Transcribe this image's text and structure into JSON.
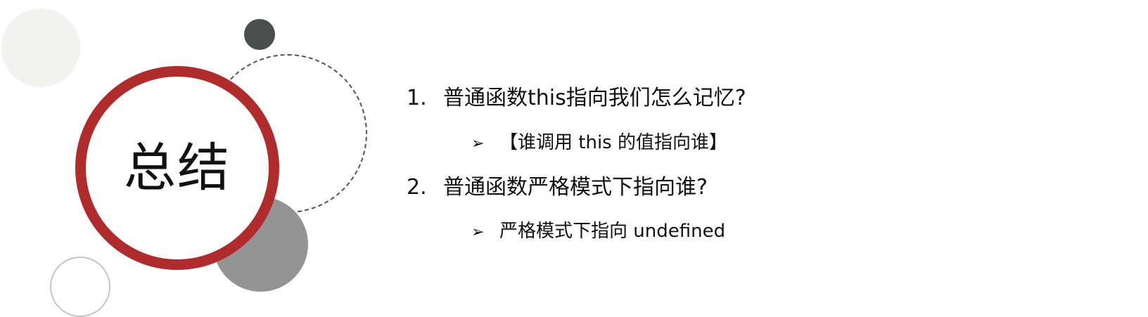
{
  "title": "总结",
  "items": [
    {
      "number": "1.",
      "question": "普通函数this指向我们怎么记忆?",
      "bullet": "➢",
      "answer": "【谁调用 this 的值指向谁】"
    },
    {
      "number": "2.",
      "question": "普通函数严格模式下指向谁?",
      "bullet": "➢",
      "answer": "严格模式下指向 undefined"
    }
  ],
  "colors": {
    "accent_red": "#b02b2b",
    "dark_gray": "#4a4f4e",
    "mid_gray": "#949494",
    "light_gray": "#f2f2f1"
  }
}
